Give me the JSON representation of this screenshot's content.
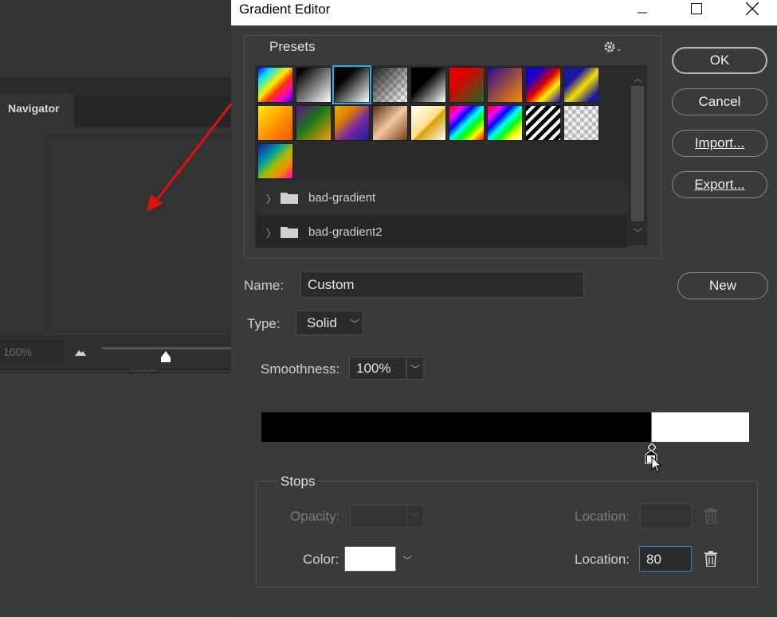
{
  "background": {
    "navigator_tab": "Navigator",
    "zoom_value": "100%"
  },
  "dialog": {
    "title": "Gradient Editor",
    "presets_label": "Presets",
    "folders": [
      "bad-gradient",
      "bad-gradient2"
    ],
    "buttons": {
      "ok": "OK",
      "cancel": "Cancel",
      "import": "Import...",
      "export": "Export...",
      "new": "New"
    },
    "name_label": "Name:",
    "name_value": "Custom",
    "type_label": "Type:",
    "type_value": "Solid",
    "smoothness_label": "Smoothness:",
    "smoothness_value": "100%",
    "stops": {
      "label": "Stops",
      "opacity_label": "Opacity:",
      "opacity_location_label": "Location:",
      "color_label": "Color:",
      "color_value": "#ffffff",
      "color_location_label": "Location:",
      "color_location_value": "80"
    },
    "gradient": {
      "stop_colors": [
        "#000000",
        "#ffffff"
      ],
      "stop_location_percent": 80
    }
  }
}
